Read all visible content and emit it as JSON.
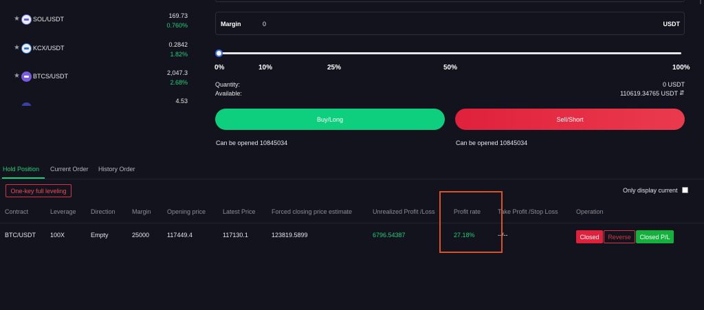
{
  "markets": [
    {
      "pair": "SOL/USDT",
      "price": "169.73",
      "change": "0.760%"
    },
    {
      "pair": "KCX/USDT",
      "price": "0.2842",
      "change": "1.82%"
    },
    {
      "pair": "BTCS/USDT",
      "price": "2,047.3",
      "change": "2.68%"
    },
    {
      "pair": "",
      "price": "4.53",
      "change": ""
    }
  ],
  "order_form": {
    "margin_label": "Margin",
    "margin_value": "0",
    "margin_unit": "USDT",
    "slider_value_percent": 0,
    "ticks": [
      "0%",
      "10%",
      "25%",
      "50%",
      "100%"
    ],
    "quantity_label": "Quantity:",
    "quantity_value": "0 USDT",
    "available_label": "Available:",
    "available_value": "110619.34765 USDT",
    "buy_label": "Buy/Long",
    "sell_label": "Sell/Short",
    "buy_can_open": "Can be opened 10845034",
    "sell_can_open": "Can be opened 10845034",
    "buy_color": "#0ecf7d",
    "sell_color": "#e0213c"
  },
  "tabs": [
    "Hold Position",
    "Current Order",
    "History Order"
  ],
  "active_tab": "Hold Position",
  "one_key_label": "One-key full leveling",
  "only_display_label": "Only display current",
  "table": {
    "headers": [
      "Contract",
      "Leverage",
      "Direction",
      "Margin",
      "Opening price",
      "Latest Price",
      "Forced closing price estimate",
      "Unrealized Profit /Loss",
      "Profit rate",
      "Take Profit /Stop Loss",
      "Operation"
    ],
    "rows": [
      {
        "contract": "BTC/USDT",
        "leverage": "100X",
        "direction": "Empty",
        "margin": "25000",
        "opening_price": "117449.4",
        "latest_price": "117130.1",
        "forced_closing": "123819.5899",
        "unrealized_pl": "6796.54387",
        "profit_rate": "27.18%",
        "tp_sl": "--/--",
        "actions": [
          "Closed",
          "Reverse",
          "Closed P/L"
        ]
      }
    ]
  },
  "colors": {
    "accent_green": "#1dd07a",
    "accent_red": "#e0213c",
    "highlight": "#d9542b"
  }
}
